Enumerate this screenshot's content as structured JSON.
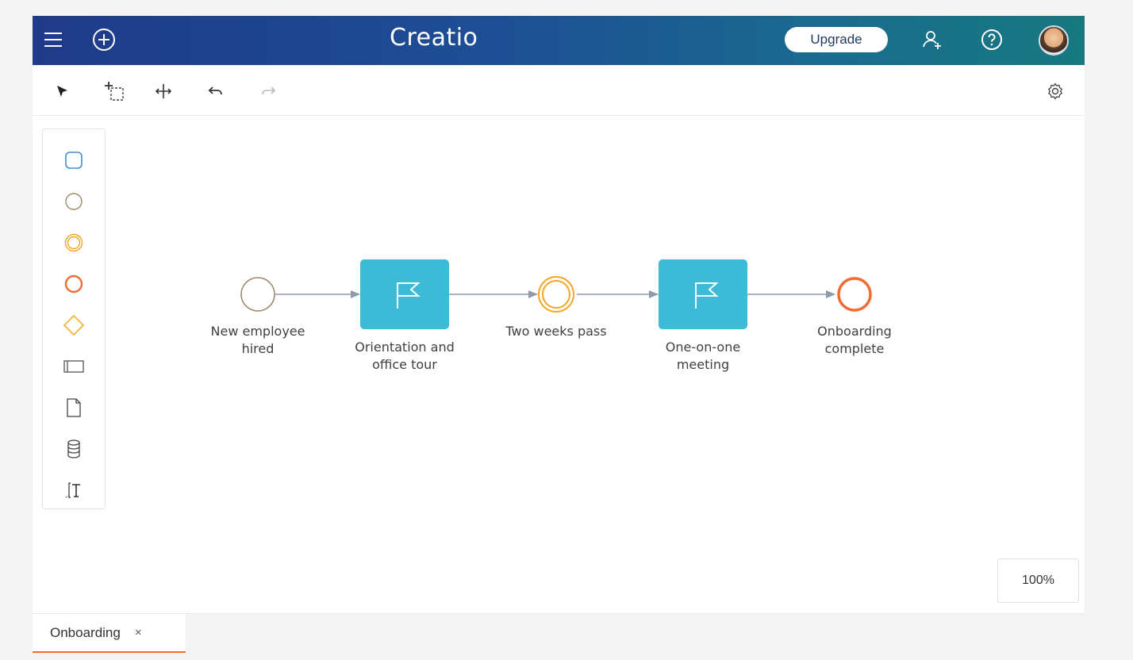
{
  "header": {
    "logo_text": "Creatio",
    "upgrade_label": "Upgrade",
    "icons": [
      "menu-icon",
      "add-circle-icon",
      "add-user-icon",
      "help-icon",
      "avatar"
    ]
  },
  "toolbar": {
    "tools": [
      "pointer-icon",
      "lasso-select-icon",
      "space-tool-icon",
      "undo-icon",
      "redo-icon"
    ],
    "settings_icon": "gear-icon"
  },
  "palette": {
    "items": [
      "task-icon",
      "start-event-icon",
      "intermediate-event-icon",
      "end-event-icon",
      "gateway-icon",
      "pool-icon",
      "data-object-icon",
      "data-store-icon",
      "text-annotation-icon"
    ]
  },
  "diagram": {
    "nodes": [
      {
        "type": "start-event",
        "label_line1": "New employee",
        "label_line2": "hired"
      },
      {
        "type": "user-task",
        "label_line1": "Orientation and",
        "label_line2": "office tour"
      },
      {
        "type": "intermediate-timer-event",
        "label_line1": "Two weeks pass",
        "label_line2": ""
      },
      {
        "type": "user-task",
        "label_line1": "One-on-one",
        "label_line2": "meeting"
      },
      {
        "type": "end-event",
        "label_line1": "Onboarding",
        "label_line2": "complete"
      }
    ]
  },
  "zoom": {
    "level": "100%"
  },
  "tabs": [
    {
      "label": "Onboarding",
      "close": "×"
    }
  ],
  "colors": {
    "header_start": "#1f3a8a",
    "header_end": "#17787f",
    "task_fill": "#3dbbd6",
    "start_event": "#9c8b6a",
    "intermediate_event": "#f5a623",
    "end_event": "#f26b35",
    "gateway": "#f5b12e",
    "connector": "#8f9aaa",
    "tab_accent": "#f26b35"
  }
}
